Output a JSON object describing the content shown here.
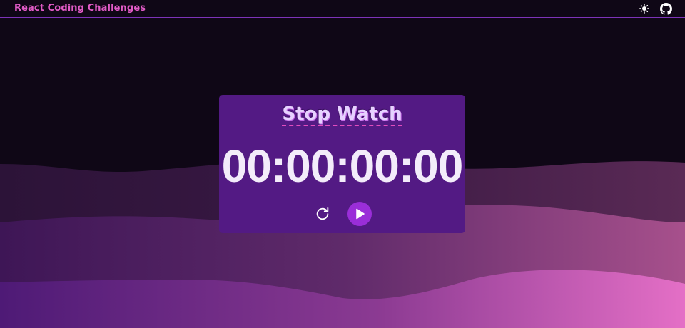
{
  "header": {
    "brand": "React Coding Challenges",
    "theme_toggle_icon": "sun-icon",
    "github_icon": "github-icon"
  },
  "stopwatch": {
    "title": "Stop Watch",
    "time": "00:00:00:00",
    "reset_icon": "reset-icon",
    "play_icon": "play-icon"
  },
  "colors": {
    "background": "#0f0716",
    "accent": "#e05bc6",
    "card": "#531a84",
    "play_button": "#9a2ed8",
    "timer_text": "#f3ecfa"
  }
}
